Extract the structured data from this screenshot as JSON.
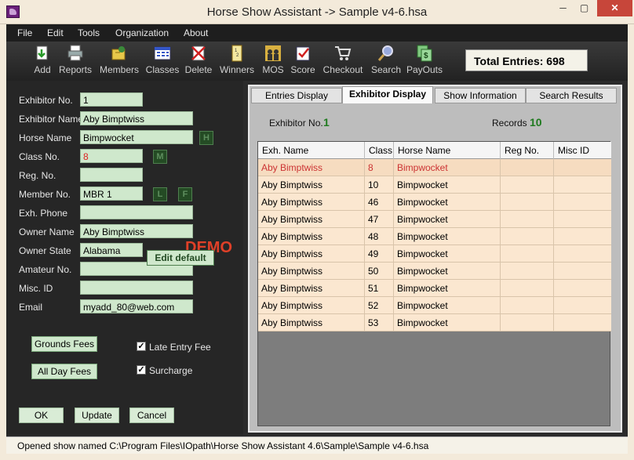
{
  "window": {
    "title": "Horse Show Assistant  ->  Sample v4-6.hsa",
    "min": "─",
    "max": "▢",
    "close": "✕"
  },
  "menu": [
    "File",
    "Edit",
    "Tools",
    "Organization",
    "About"
  ],
  "toolbar": {
    "items": [
      {
        "label": "Add",
        "icon": "add-icon"
      },
      {
        "label": "Reports",
        "icon": "printer-icon"
      },
      {
        "label": "Members",
        "icon": "members-icon"
      },
      {
        "label": "Classes",
        "icon": "classes-icon"
      },
      {
        "label": "Delete",
        "icon": "delete-icon"
      },
      {
        "label": "Winners",
        "icon": "winners-icon"
      },
      {
        "label": "MOS",
        "icon": "mos-icon"
      },
      {
        "label": "Score",
        "icon": "score-icon"
      },
      {
        "label": "Checkout",
        "icon": "cart-icon"
      },
      {
        "label": "Search",
        "icon": "search-icon"
      },
      {
        "label": "PayOuts",
        "icon": "payouts-icon"
      }
    ],
    "total_entries": "Total Entries:  698"
  },
  "form": {
    "fields": [
      {
        "label": "Exhibitor No.",
        "value": "1"
      },
      {
        "label": "Exhibitor Name",
        "value": "Aby Bimptwiss"
      },
      {
        "label": "Horse Name",
        "value": "Bimpwocket"
      },
      {
        "label": "Class No.",
        "value": "8"
      },
      {
        "label": "Reg. No.",
        "value": ""
      },
      {
        "label": "Member No.",
        "value": "MBR 1"
      },
      {
        "label": "Exh. Phone",
        "value": ""
      },
      {
        "label": "Owner Name",
        "value": "Aby Bimptwiss"
      },
      {
        "label": "Owner State",
        "value": "Alabama"
      },
      {
        "label": "Amateur No.",
        "value": ""
      },
      {
        "label": "Misc. ID",
        "value": ""
      },
      {
        "label": "Email",
        "value": "myadd_80@web.com"
      }
    ],
    "sq_h": "H",
    "sq_m": "M",
    "sq_l": "L",
    "sq_f": "F",
    "demo": "DEMO",
    "edit_default": "Edit default",
    "grounds_fees": "Grounds Fees",
    "all_day_fees": "All Day Fees",
    "late_entry_fee": "Late Entry Fee",
    "surcharge": "Surcharge",
    "check_mark": "✓",
    "ok": "OK",
    "update": "Update",
    "cancel": "Cancel"
  },
  "tabs": [
    "Entries Display",
    "Exhibitor Display",
    "Show Information",
    "Search Results"
  ],
  "summary": {
    "exhibitor_label": "Exhibitor No.",
    "exhibitor_value": "1",
    "records_label": "Records",
    "records_value": "10"
  },
  "table": {
    "columns": [
      "Exh. Name",
      "Class",
      "Horse Name",
      "Reg No.",
      "Misc ID"
    ],
    "rows": [
      [
        "Aby Bimptwiss",
        "8",
        "Bimpwocket",
        "",
        ""
      ],
      [
        "Aby Bimptwiss",
        "10",
        "Bimpwocket",
        "",
        ""
      ],
      [
        "Aby Bimptwiss",
        "46",
        "Bimpwocket",
        "",
        ""
      ],
      [
        "Aby Bimptwiss",
        "47",
        "Bimpwocket",
        "",
        ""
      ],
      [
        "Aby Bimptwiss",
        "48",
        "Bimpwocket",
        "",
        ""
      ],
      [
        "Aby Bimptwiss",
        "49",
        "Bimpwocket",
        "",
        ""
      ],
      [
        "Aby Bimptwiss",
        "50",
        "Bimpwocket",
        "",
        ""
      ],
      [
        "Aby Bimptwiss",
        "51",
        "Bimpwocket",
        "",
        ""
      ],
      [
        "Aby Bimptwiss",
        "52",
        "Bimpwocket",
        "",
        ""
      ],
      [
        "Aby Bimptwiss",
        "53",
        "Bimpwocket",
        "",
        ""
      ]
    ]
  },
  "status": "Opened show named C:\\Program Files\\IOpath\\Horse Show Assistant 4.6\\Sample\\Sample v4-6.hsa"
}
